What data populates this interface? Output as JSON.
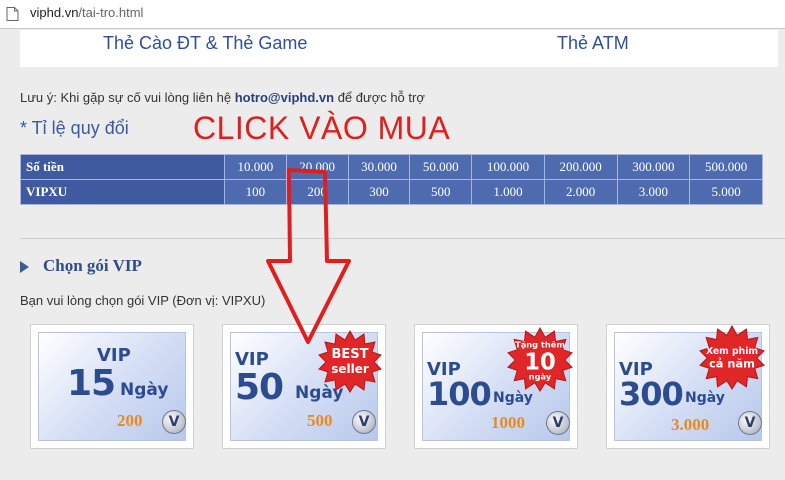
{
  "browser": {
    "address_host": "viphd.vn",
    "address_path": "/tai-tro.html"
  },
  "tabs": [
    "Thẻ Cào ĐT & Thẻ Game",
    "Thẻ ATM"
  ],
  "notice": {
    "prefix": "Lưu ý: Khi gặp sự cố vui lòng liên hệ",
    "email": "hotro@viphd.vn",
    "suffix": "để được hỗ trợ"
  },
  "rate": {
    "title": "* Tỉ lệ quy đổi",
    "row1_label": "Số tiền",
    "row1": [
      "10.000",
      "20.000",
      "30.000",
      "50.000",
      "100.000",
      "200.000",
      "300.000",
      "500.000"
    ],
    "row2_label": "VIPXU",
    "row2": [
      "100",
      "200",
      "300",
      "500",
      "1.000",
      "2.000",
      "3.000",
      "5.000"
    ]
  },
  "annotation": {
    "text": "CLICK VÀO MUA",
    "color": "#e01e1e"
  },
  "vip": {
    "heading": "Chọn gói VIP",
    "subtitle": "Bạn vui lòng chọn gói VIP (Đơn vị: VIPXU)",
    "packages": [
      {
        "vip": "VIP",
        "days": "15",
        "unit": "Ngày",
        "price": "200",
        "coin": "V"
      },
      {
        "vip": "VIP",
        "days": "50",
        "unit": "Ngày",
        "price": "500",
        "coin": "V",
        "badge_line1": "BEST",
        "badge_line2": "seller"
      },
      {
        "vip": "VIP",
        "days": "100",
        "unit": "Ngày",
        "price": "1000",
        "coin": "V",
        "badge_line1": "Tặng thêm",
        "badge_line2": "10",
        "badge_line3": "ngày"
      },
      {
        "vip": "VIP",
        "days": "300",
        "unit": "Ngày",
        "price": "3.000",
        "coin": "V",
        "badge_line1": "Xem phim",
        "badge_line2": "cả năm"
      }
    ]
  },
  "colors": {
    "accent_blue": "#2e4f9c",
    "table_blue": "#4f6bb0",
    "price_orange": "#e78b1c",
    "badge_red": "#e02626"
  }
}
